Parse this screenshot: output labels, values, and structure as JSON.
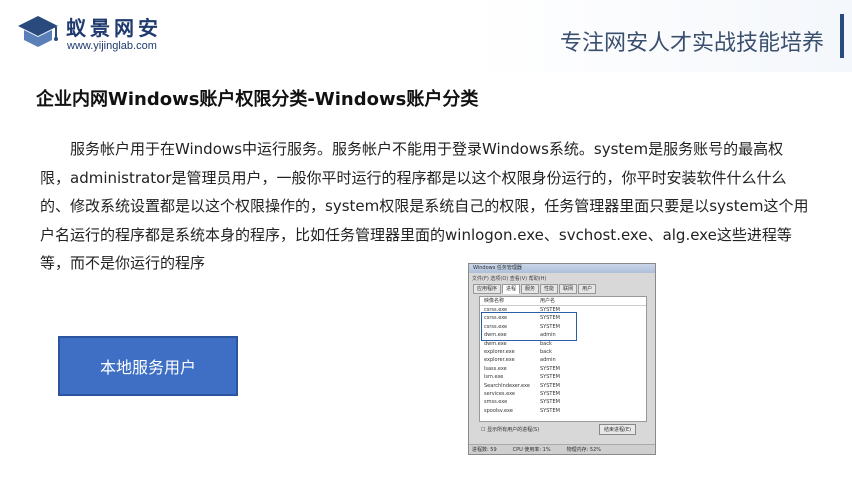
{
  "header": {
    "brand_name": "蚁景网安",
    "brand_url": "www.yijinglab.com",
    "slogan": "专注网安人才实战技能培养"
  },
  "title": "企业内网Windows账户权限分类-Windows账户分类",
  "paragraph": "服务帐户用于在Windows中运行服务。服务帐户不能用于登录Windows系统。system是服务账号的最高权限，administrator是管理员用户，一般你平时运行的程序都是以这个权限身份运行的，你平时安装软件什么什么的、修改系统设置都是以这个权限操作的，system权限是系统自己的权限，任务管理器里面只要是以system这个用户名运行的程序都是系统本身的程序，比如任务管理器里面的winlogon.exe、svchost.exe、alg.exe这些进程等等，而不是你运行的程序",
  "box_label": "本地服务用户",
  "task_manager": {
    "window_title": "Windows 任务管理器",
    "menu": "文件(F)  选项(O)  查看(V)  帮助(H)",
    "tabs": [
      "应用程序",
      "进程",
      "服务",
      "性能",
      "联网",
      "用户"
    ],
    "columns": [
      "映像名称",
      "用户名"
    ],
    "rows": [
      {
        "name": "csrss.exe",
        "user": "SYSTEM"
      },
      {
        "name": "csrss.exe",
        "user": "SYSTEM"
      },
      {
        "name": "csrss.exe",
        "user": "SYSTEM"
      },
      {
        "name": "dwm.exe",
        "user": "admin"
      },
      {
        "name": "dwm.exe",
        "user": "back"
      },
      {
        "name": "explorer.exe",
        "user": "back"
      },
      {
        "name": "explorer.exe",
        "user": "admin"
      },
      {
        "name": "lsass.exe",
        "user": "SYSTEM"
      },
      {
        "name": "lsm.exe",
        "user": "SYSTEM"
      },
      {
        "name": "SearchIndexer.exe",
        "user": "SYSTEM"
      },
      {
        "name": "services.exe",
        "user": "SYSTEM"
      },
      {
        "name": "smss.exe",
        "user": "SYSTEM"
      },
      {
        "name": "spoolsv.exe",
        "user": "SYSTEM"
      }
    ],
    "show_all_label": "显示所有用户的进程(S)",
    "end_process_label": "结束进程(E)",
    "status_processes": "进程数: 59",
    "status_cpu": "CPU 使用率: 1%",
    "status_memory": "物理内存: 52%"
  }
}
